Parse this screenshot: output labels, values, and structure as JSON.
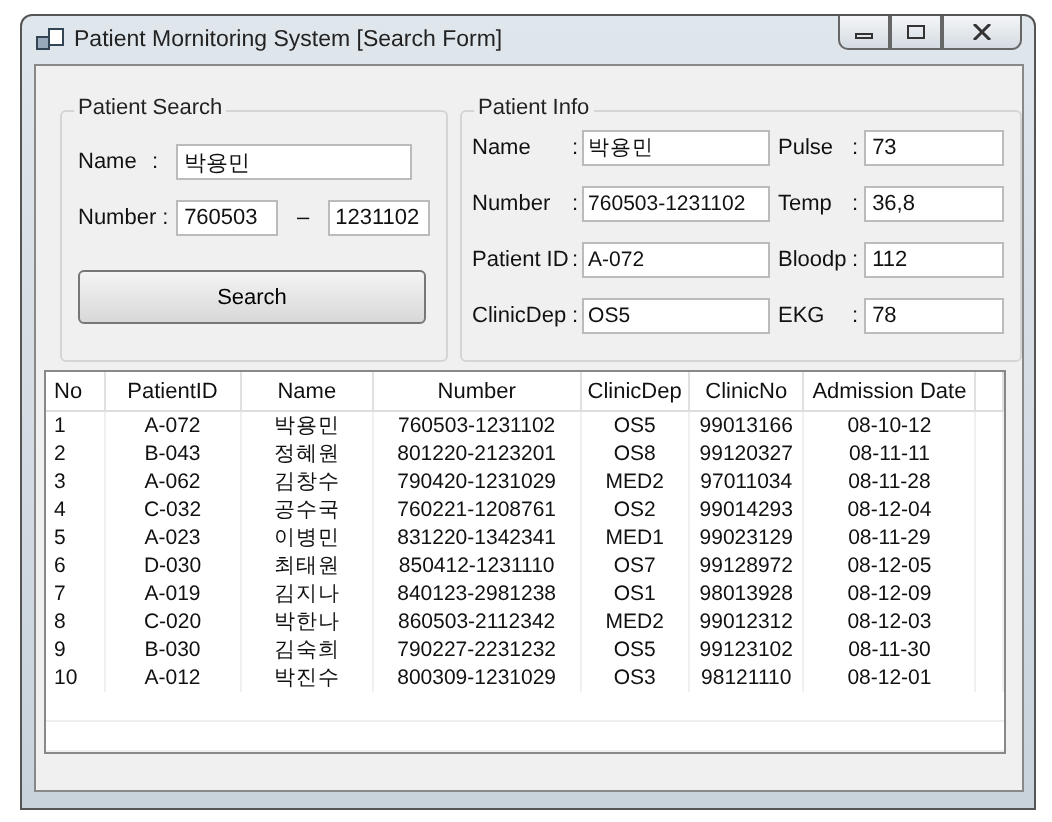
{
  "window": {
    "title": "Patient Mornitoring System [Search Form]"
  },
  "patient_search": {
    "title": "Patient Search",
    "name_label": "Name",
    "name_colon": ":",
    "name_value": "박용민",
    "number_label": "Number :",
    "number_first": "760503",
    "number_dash": "–",
    "number_second": "1231102",
    "search_button": "Search"
  },
  "patient_info": {
    "title": "Patient Info",
    "fields": [
      {
        "label": "Name",
        "colon": ":",
        "value": "박용민"
      },
      {
        "label": "Pulse",
        "colon": ":",
        "value": "73"
      },
      {
        "label": "Number",
        "colon": ":",
        "value": "760503-1231102"
      },
      {
        "label": "Temp",
        "colon": ":",
        "value": "36,8"
      },
      {
        "label": "Patient ID",
        "colon": ":",
        "value": "A-072"
      },
      {
        "label": "Bloodp",
        "colon": ":",
        "value": "112"
      },
      {
        "label": "ClinicDep",
        "colon": ":",
        "value": "OS5"
      },
      {
        "label": "EKG",
        "colon": ":",
        "value": "78"
      }
    ]
  },
  "table": {
    "columns": [
      "No",
      "PatientID",
      "Name",
      "Number",
      "ClinicDep",
      "ClinicNo",
      "Admission Date"
    ],
    "rows": [
      [
        "1",
        "A-072",
        "박용민",
        "760503-1231102",
        "OS5",
        "99013166",
        "08-10-12"
      ],
      [
        "2",
        "B-043",
        "정혜원",
        "801220-2123201",
        "OS8",
        "99120327",
        "08-11-11"
      ],
      [
        "3",
        "A-062",
        "김창수",
        "790420-1231029",
        "MED2",
        "97011034",
        "08-11-28"
      ],
      [
        "4",
        "C-032",
        "공수국",
        "760221-1208761",
        "OS2",
        "99014293",
        "08-12-04"
      ],
      [
        "5",
        "A-023",
        "이병민",
        "831220-1342341",
        "MED1",
        "99023129",
        "08-11-29"
      ],
      [
        "6",
        "D-030",
        "최태원",
        "850412-1231110",
        "OS7",
        "99128972",
        "08-12-05"
      ],
      [
        "7",
        "A-019",
        "김지나",
        "840123-2981238",
        "OS1",
        "98013928",
        "08-12-09"
      ],
      [
        "8",
        "C-020",
        "박한나",
        "860503-2112342",
        "MED2",
        "99012312",
        "08-12-03"
      ],
      [
        "9",
        "B-030",
        "김숙희",
        "790227-2231232",
        "OS5",
        "99123102",
        "08-11-30"
      ],
      [
        "10",
        "A-012",
        "박진수",
        "800309-1231029",
        "OS3",
        "98121110",
        "08-12-01"
      ]
    ]
  }
}
